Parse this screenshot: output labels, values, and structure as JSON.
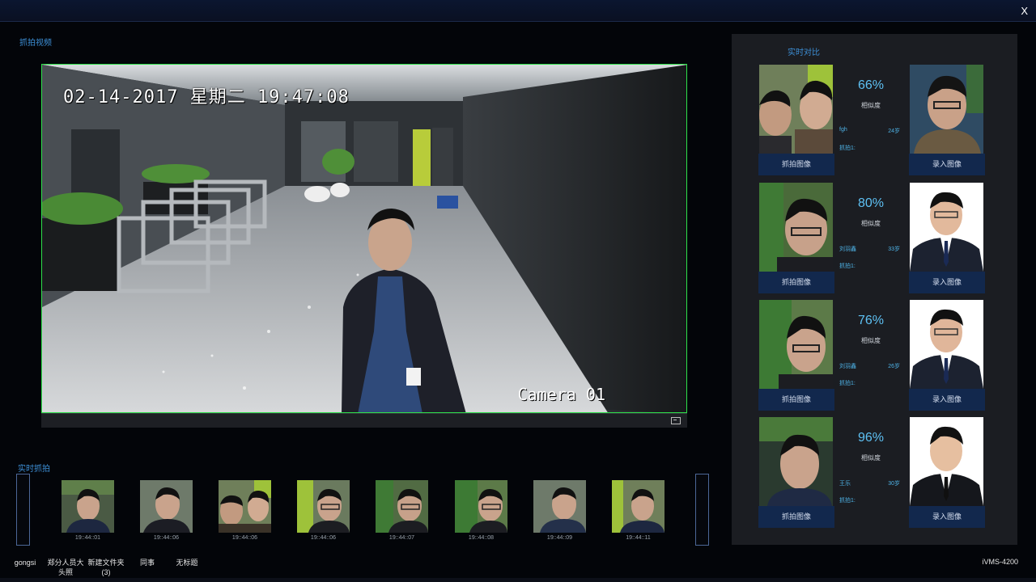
{
  "window": {
    "close_label": "X"
  },
  "video_section": {
    "title": "抓拍视频"
  },
  "video": {
    "osd_time": "02-14-2017 星期二 19:47:08",
    "camera_label": "Camera 01"
  },
  "compare_panel": {
    "title": "实时对比",
    "rows": [
      {
        "percent": "66%",
        "similarity_label": "相似度",
        "name": "fgh",
        "age": "24岁",
        "source": "抓拍1:",
        "capture_button": "抓拍图像",
        "ref_button": "录入图像"
      },
      {
        "percent": "80%",
        "similarity_label": "相似度",
        "name": "刘羽鑫",
        "age": "33岁",
        "source": "抓拍1:",
        "capture_button": "抓拍图像",
        "ref_button": "录入图像"
      },
      {
        "percent": "76%",
        "similarity_label": "相似度",
        "name": "刘羽鑫",
        "age": "26岁",
        "source": "抓拍1:",
        "capture_button": "抓拍图像",
        "ref_button": "录入图像"
      },
      {
        "percent": "96%",
        "similarity_label": "相似度",
        "name": "王乐",
        "age": "30岁",
        "source": "抓拍1:",
        "capture_button": "抓拍图像",
        "ref_button": "录入图像"
      }
    ]
  },
  "thumbs_section": {
    "title": "实时抓拍",
    "items": [
      {
        "time": "19::44::01"
      },
      {
        "time": "19::44::06"
      },
      {
        "time": "19::44::06"
      },
      {
        "time": "19::44::06"
      },
      {
        "time": "19::44::07"
      },
      {
        "time": "19::44::08"
      },
      {
        "time": "19::44::09"
      },
      {
        "time": "19::44::11"
      }
    ]
  },
  "taskbar": {
    "items": [
      {
        "label": "gongsi"
      },
      {
        "label": "郑分人员大头照"
      },
      {
        "label": "新建文件夹 (3)"
      },
      {
        "label": "同事"
      },
      {
        "label": "无标题"
      }
    ],
    "brand": "iVMS-4200"
  }
}
